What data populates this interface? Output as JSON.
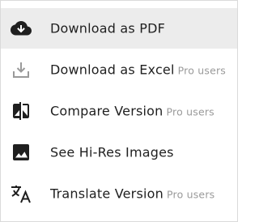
{
  "menu": {
    "items": [
      {
        "label": "Download as PDF",
        "badge": "",
        "icon": "cloud-download-icon",
        "highlighted": true
      },
      {
        "label": "Download as Excel",
        "badge": "Pro users",
        "icon": "tray-download-icon",
        "highlighted": false
      },
      {
        "label": "Compare Version",
        "badge": "Pro users",
        "icon": "compare-icon",
        "highlighted": false
      },
      {
        "label": "See Hi-Res Images",
        "badge": "",
        "icon": "image-icon",
        "highlighted": false
      },
      {
        "label": "Translate Version",
        "badge": "Pro users",
        "icon": "translate-icon",
        "highlighted": false
      }
    ]
  },
  "colors": {
    "highlight_bg": "#ececec",
    "text": "#1f1f1f",
    "badge_text": "#9a9a9a",
    "icon_dark": "#1f1f1f",
    "icon_muted": "#9a9a9a"
  }
}
